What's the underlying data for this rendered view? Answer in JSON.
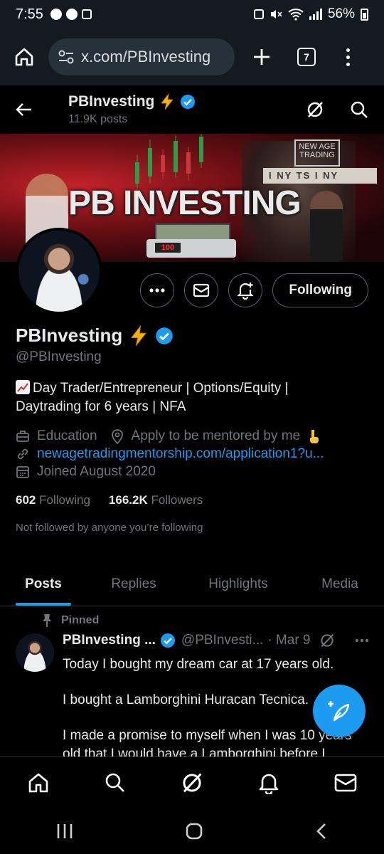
{
  "status_bar": {
    "time": "7:55",
    "battery": "56%"
  },
  "browser": {
    "url": "x.com/PBInvesting",
    "tab_count": "7"
  },
  "header": {
    "name": "PBInvesting",
    "post_count": "11.9K posts"
  },
  "banner": {
    "title": "PB INVESTING",
    "counter": "100",
    "logo": "NEW AGE TRADING",
    "sign": "I NY  TS I NY"
  },
  "profile": {
    "display_name": "PBInvesting",
    "handle": "@PBInvesting",
    "bio_line1": "Day Trader/Entrepreneur | Options/Equity |",
    "bio_line2": "Daytrading for 6 years | NFA",
    "category": "Education",
    "location": "Apply to be mentored by me",
    "website": "newagetradingmentorship.com/application1?u...",
    "joined": "Joined August 2020",
    "following_count": "602",
    "following_label": "Following",
    "followers_count": "166.2K",
    "followers_label": "Followers",
    "not_followed": "Not followed by anyone you’re following",
    "follow_button": "Following"
  },
  "tabs": [
    {
      "label": "Posts",
      "active": true
    },
    {
      "label": "Replies",
      "active": false
    },
    {
      "label": "Highlights",
      "active": false
    },
    {
      "label": "Media",
      "active": false
    }
  ],
  "post": {
    "pinned_label": "Pinned",
    "author": "PBInvesting ...",
    "handle": "@PBInvesti...",
    "date": "· Mar 9",
    "line1": "Today I bought my dream car at 17 years old.",
    "line2": "I bought a Lamborghini Huracan Tecnica.",
    "line3": "I made a promise to myself when I was 10 years",
    "line4": "old that I would have a Lamborghini before I"
  },
  "colors": {
    "accent": "#1d9bf0",
    "background": "#000000",
    "muted": "#71767b",
    "verified": "#1d9bf0",
    "bolt": "#f4b400"
  }
}
